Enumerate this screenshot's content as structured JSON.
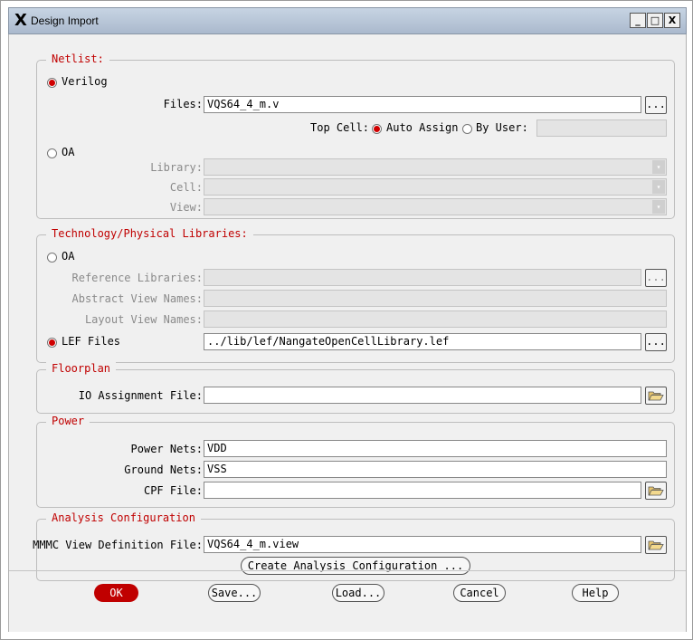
{
  "window": {
    "title": "Design Import",
    "icon": "x-window-icon",
    "minimize": "_",
    "maximize": "□",
    "close": "X"
  },
  "netlist": {
    "legend": "Netlist:",
    "verilog_label": "Verilog",
    "verilog_selected": true,
    "files_label": "Files:",
    "files_value": "VQS64_4_m.v",
    "browse": "...",
    "top_cell_label": "Top Cell:",
    "auto_assign_label": "Auto Assign",
    "by_user_label": "By User:",
    "by_user_value": "",
    "oa_label": "OA",
    "library_label": "Library:",
    "cell_label": "Cell:",
    "view_label": "View:"
  },
  "tech": {
    "legend": "Technology/Physical Libraries:",
    "oa_label": "OA",
    "ref_libs_label": "Reference Libraries:",
    "abstract_label": "Abstract View Names:",
    "layout_label": "Layout View Names:",
    "lef_label": "LEF Files",
    "lef_selected": true,
    "lef_value": "../lib/lef/NangateOpenCellLibrary.lef",
    "browse": "..."
  },
  "floorplan": {
    "legend": "Floorplan",
    "io_label": "IO Assignment File:",
    "io_value": ""
  },
  "power": {
    "legend": "Power",
    "power_nets_label": "Power Nets:",
    "power_nets_value": "VDD",
    "ground_nets_label": "Ground Nets:",
    "ground_nets_value": "VSS",
    "cpf_label": "CPF File:",
    "cpf_value": ""
  },
  "analysis": {
    "legend": "Analysis Configuration",
    "mmmc_label": "MMMC View Definition File:",
    "mmmc_value": "VQS64_4_m.view",
    "create_button": "Create Analysis Configuration ..."
  },
  "buttons": {
    "ok": "OK",
    "save": "Save...",
    "load": "Load...",
    "cancel": "Cancel",
    "help": "Help"
  },
  "colors": {
    "accent": "#c00000",
    "disabled_field": "#e4e4e4",
    "background": "#f0f0f0"
  }
}
